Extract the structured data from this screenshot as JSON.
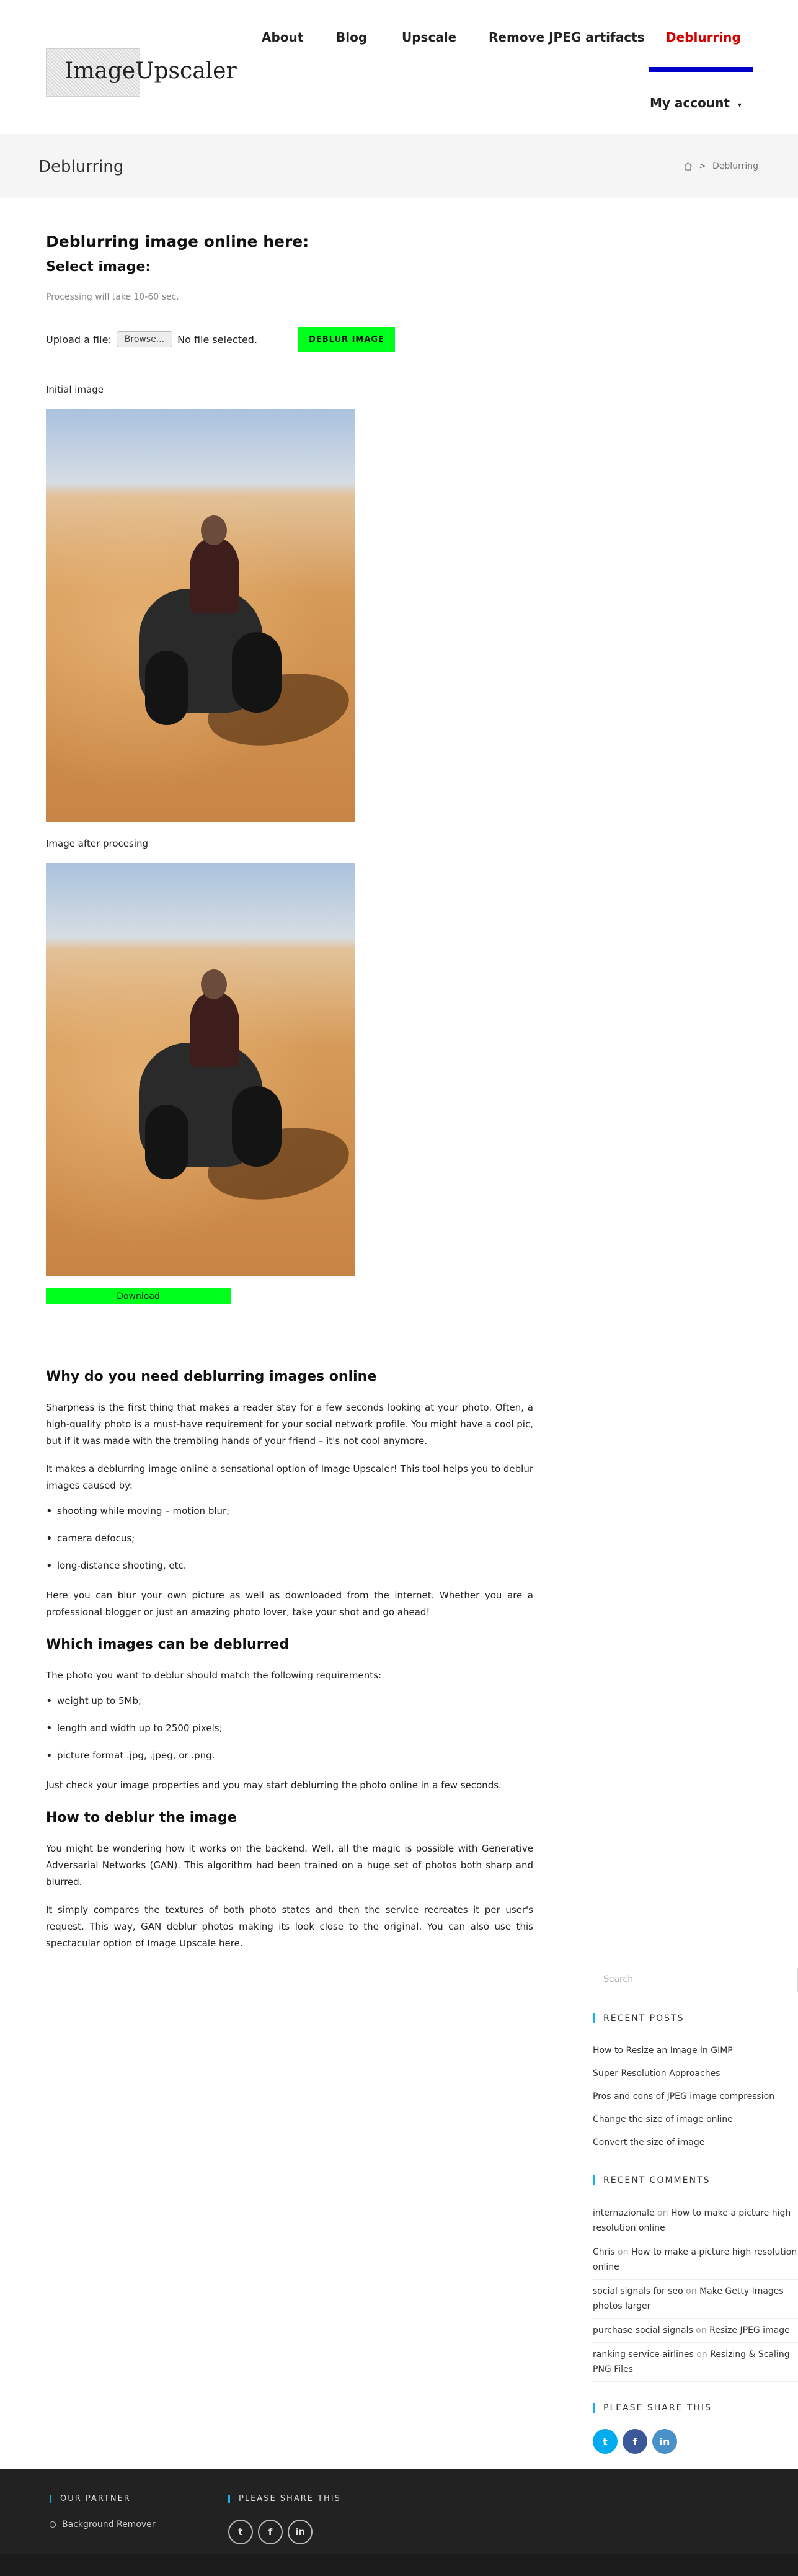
{
  "header": {
    "logo_text": "ImageUpscaler",
    "nav": [
      "About",
      "Blog",
      "Upscale",
      "Remove JPEG artifacts",
      "Deblurring"
    ],
    "active_nav": "Deblurring",
    "my_account": "My account"
  },
  "page": {
    "title": "Deblurring",
    "breadcrumb": ">",
    "breadcrumb_current": "Deblurring"
  },
  "tool": {
    "heading": "Deblurring image online here:",
    "select_label": "Select image:",
    "note": "Processing will take 10-60 sec.",
    "upload_label": "Upload a file:",
    "browse": "Browse...",
    "no_file": "No file selected.",
    "deblur_button": "DEBLUR IMAGE",
    "initial_label": "Initial image",
    "after_label": "Image after procesing",
    "download": "Download"
  },
  "article": {
    "h1": "Why do you need deblurring images online",
    "p1": "Sharpness is the first thing that makes a reader stay for a few seconds looking at your photo. Often, a high-quality photo is a must-have requirement for your social network profile. You might have a cool pic, but if it was made with the trembling hands of your friend – it's not cool anymore.",
    "p2": "It makes a deblurring image online a sensational option of Image Upscaler! This tool helps you to deblur images caused by:",
    "list1": [
      "shooting while moving – motion blur;",
      "camera defocus;",
      "long-distance shooting, etc."
    ],
    "p3": "Here you can blur your own picture as well as downloaded from the internet. Whether you are a professional blogger or just an amazing photo lover, take your shot and go ahead!",
    "h2": "Which images can be deblurred",
    "p4": "The photo you want to deblur should match the following requirements:",
    "list2": [
      "weight up to 5Mb;",
      "length and width up to 2500 pixels;",
      "picture format .jpg, .jpeg, or .png."
    ],
    "p5": "Just check your image properties and you may start deblurring the photo online in a few seconds.",
    "h3": "How to deblur the image",
    "p6": "You might be wondering how it works on the backend. Well, all the magic is possible with Generative Adversarial Networks (GAN). This algorithm had been trained on a huge set of photos both sharp and blurred.",
    "p7": "It simply compares the textures of both photo states and then the service recreates it per user's request. This way, GAN deblur photos making its look close to the original. You can also use this spectacular option of Image Upscale here."
  },
  "sidebar": {
    "search_placeholder": "Search",
    "recent_posts_title": "RECENT POSTS",
    "recent_posts": [
      "How to Resize an Image in GIMP",
      "Super Resolution Approaches",
      "Pros and cons of JPEG image compression",
      "Change the size of image online",
      "Convert the size of image"
    ],
    "recent_comments_title": "RECENT COMMENTS",
    "on_word": "on",
    "recent_comments": [
      {
        "author": "internazionale",
        "post": "How to make a picture high resolution online"
      },
      {
        "author": "Chris",
        "post": "How to make a picture high resolution online"
      },
      {
        "author": "social signals for seo",
        "post": "Make Getty Images photos larger"
      },
      {
        "author": "purchase social signals",
        "post": "Resize JPEG image"
      },
      {
        "author": "ranking service airlines",
        "post": "Resizing & Scaling PNG Files"
      }
    ],
    "share_title": "PLEASE SHARE THIS",
    "share_colors": [
      "#00aced",
      "#3b5998",
      "#4a90c9"
    ],
    "share_glyphs": [
      "t",
      "f",
      "in"
    ]
  },
  "footer": {
    "partner_title": "OUR PARTNER",
    "partner_link": "Background Remover",
    "share_title": "PLEASE SHARE THIS",
    "share_glyphs": [
      "t",
      "f",
      "in"
    ]
  }
}
